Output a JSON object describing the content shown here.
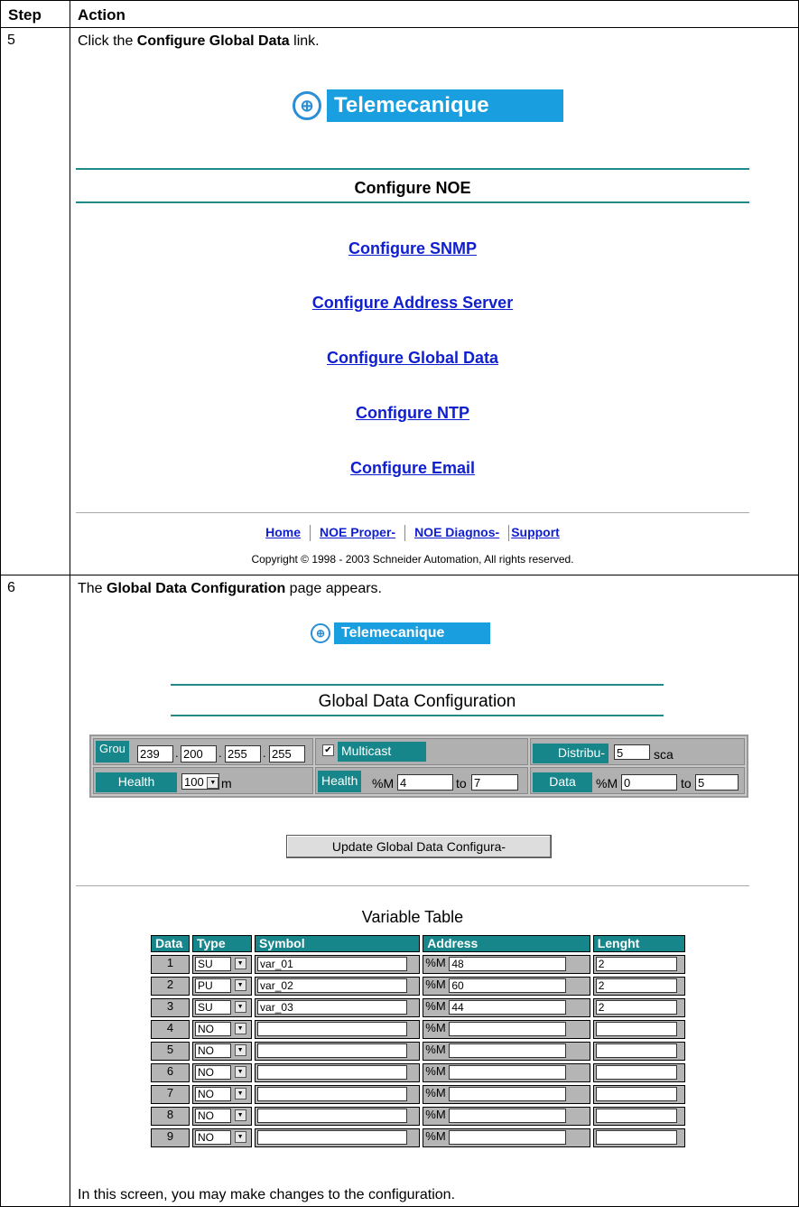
{
  "table": {
    "header_step": "Step",
    "header_action": "Action"
  },
  "row5": {
    "step": "5",
    "instruction_pre": "Click the ",
    "instruction_bold": "Configure Global Data",
    "instruction_post": " link.",
    "logo_text": "Telemecanique",
    "page_heading": "Configure  NOE",
    "links": [
      "Configure  SNMP",
      "Configure  Address  Server",
      "Configure  Global  Data",
      "Configure  NTP",
      "Configure  Email"
    ],
    "footer_links": [
      "Home",
      "NOE Proper-",
      "NOE Diagnos-",
      "Support"
    ],
    "copyright": "Copyright © 1998 - 2003 Schneider Automation, All rights reserved."
  },
  "row6": {
    "step": "6",
    "instruction_pre": "The ",
    "instruction_bold": "Global Data Configuration",
    "instruction_post": " page appears.",
    "logo_text": "Telemecanique",
    "page_heading": "Global  Data  Configuration",
    "config": {
      "group_label": "Grou",
      "ip": [
        "239",
        "200",
        "255",
        "255"
      ],
      "multicast_label": "Multicast",
      "multicast_checked": true,
      "distrib_label": "Distribu-",
      "distrib_value": "5",
      "distrib_unit": "sca",
      "health_label": "Health",
      "health_value": "100",
      "health_unit": "m",
      "health2_label": "Health",
      "health2_prefix": "%M",
      "health2_from": "4",
      "health2_to_label": "to",
      "health2_to": "7",
      "data_label": "Data",
      "data_prefix": "%M",
      "data_from": "0",
      "data_to_label": "to",
      "data_to": "5"
    },
    "update_button": "Update  Global  Data  Configura-",
    "variable_table_title": "Variable  Table",
    "vt_headers": [
      "Data",
      "Type",
      "Symbol",
      "Address",
      "Lenght"
    ],
    "vt_rows": [
      {
        "data": "1",
        "type": "SU",
        "symbol": "var_01",
        "prefix": "%M",
        "address": "48",
        "length": "2"
      },
      {
        "data": "2",
        "type": "PU",
        "symbol": "var_02",
        "prefix": "%M",
        "address": "60",
        "length": "2"
      },
      {
        "data": "3",
        "type": "SU",
        "symbol": "var_03",
        "prefix": "%M",
        "address": "44",
        "length": "2"
      },
      {
        "data": "4",
        "type": "NO",
        "symbol": "",
        "prefix": "%M",
        "address": "",
        "length": ""
      },
      {
        "data": "5",
        "type": "NO",
        "symbol": "",
        "prefix": "%M",
        "address": "",
        "length": ""
      },
      {
        "data": "6",
        "type": "NO",
        "symbol": "",
        "prefix": "%M",
        "address": "",
        "length": ""
      },
      {
        "data": "7",
        "type": "NO",
        "symbol": "",
        "prefix": "%M",
        "address": "",
        "length": ""
      },
      {
        "data": "8",
        "type": "NO",
        "symbol": "",
        "prefix": "%M",
        "address": "",
        "length": ""
      },
      {
        "data": "9",
        "type": "NO",
        "symbol": "",
        "prefix": "%M",
        "address": "",
        "length": ""
      }
    ],
    "closing_text": "In this screen, you may make changes to the configuration."
  },
  "colors": {
    "teal": "#17868a",
    "brand_blue": "#199fe0",
    "link_blue": "#1020d0"
  }
}
